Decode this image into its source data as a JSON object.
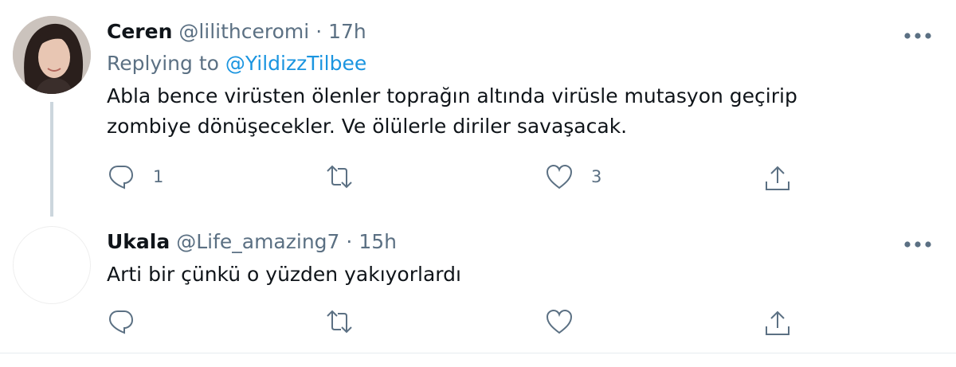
{
  "tweets": [
    {
      "name": "Ceren",
      "handle": "@lilithceromi",
      "separator": "·",
      "time": "17h",
      "replying_label": "Replying to",
      "replying_to": "@YildizzTilbee",
      "text_line1": "Abla bence virüsten ölenler toprağın altında virüsle mutasyon geçirip",
      "text_line2": "zombiye dönüşecekler. Ve ölülerle diriler savaşacak.",
      "reply_count": "1",
      "retweet_count": "",
      "like_count": "3"
    },
    {
      "name": "Ukala",
      "handle": "@Life_amazing7",
      "separator": "·",
      "time": "15h",
      "text": "Arti bir çünkü o yüzden yakıyorlardı",
      "reply_count": "",
      "retweet_count": "",
      "like_count": ""
    }
  ],
  "icons": {
    "reply": "reply-icon",
    "retweet": "retweet-icon",
    "like": "heart-icon",
    "share": "share-icon",
    "more": "more-icon"
  },
  "colors": {
    "link": "#1b95e0",
    "secondary": "#5b7083",
    "thread_line": "#ccd6dd"
  }
}
